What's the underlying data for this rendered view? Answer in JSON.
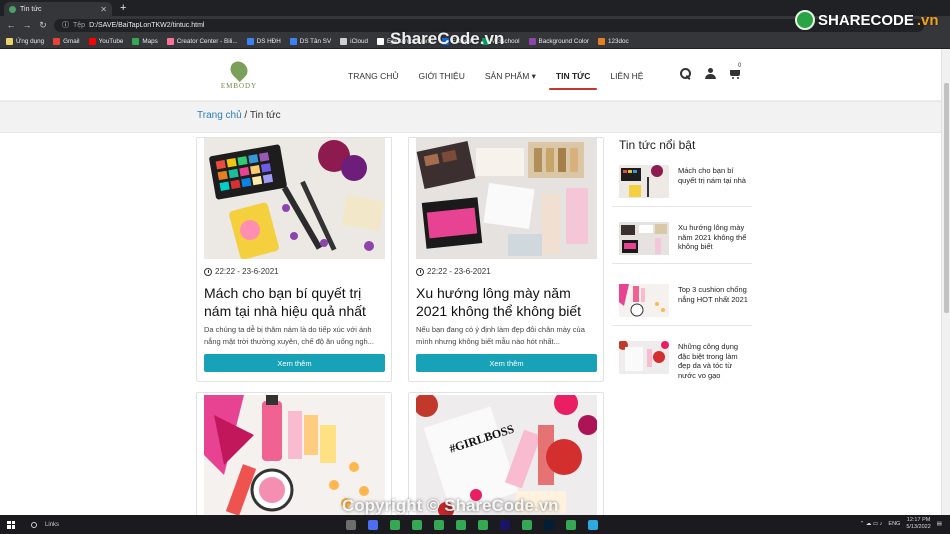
{
  "browser": {
    "tab_title": "Tin tức",
    "address_prefix": "Tệp",
    "address": "D:/SAVE/BaiTapLonTKW2/tintuc.html",
    "bookmarks": [
      {
        "label": "Ứng dụng",
        "color": "#e8d36a"
      },
      {
        "label": "Gmail",
        "color": "#ea4335"
      },
      {
        "label": "YouTube",
        "color": "#ff0000"
      },
      {
        "label": "Maps",
        "color": "#34a853"
      },
      {
        "label": "Creator Center - Bili...",
        "color": "#fb7299"
      },
      {
        "label": "DS HĐH",
        "color": "#3b82f6"
      },
      {
        "label": "DS Tân SV",
        "color": "#3b82f6"
      },
      {
        "label": "iCloud",
        "color": "#cfcfcf"
      },
      {
        "label": "Epidemic Sound",
        "color": "#ffffff"
      },
      {
        "label": "Freepik",
        "color": "#1273eb"
      },
      {
        "label": "W3school",
        "color": "#04aa6d"
      },
      {
        "label": "Background Color",
        "color": "#8e44ad"
      },
      {
        "label": "123doc",
        "color": "#e67e22"
      }
    ]
  },
  "site": {
    "logo_text": "EMBODY",
    "menu": [
      {
        "label": "TRANG CHỦ"
      },
      {
        "label": "GIỚI THIỆU"
      },
      {
        "label": "SẢN PHẨM ▾"
      },
      {
        "label": "TIN TỨC",
        "active": true
      },
      {
        "label": "LIÊN HỆ"
      }
    ],
    "cart_count": "0",
    "breadcrumb": {
      "home": "Trang chủ",
      "sep": " / ",
      "current": "Tin tức"
    }
  },
  "articles": [
    {
      "date": "22:22 - 23-6-2021",
      "title": "Mách cho bạn bí quyết trị nám tại nhà hiệu quả nhất",
      "excerpt": "Da chúng ta dễ bị thâm nám là do tiếp xúc với ánh nắng mặt trời thường xuyên, chế độ ăn uống ngh...",
      "button": "Xem thêm"
    },
    {
      "date": "22:22 - 23-6-2021",
      "title": "Xu hướng lông mày năm 2021 không thể không biết",
      "excerpt": "Nếu bạn đang có ý định làm đẹp đôi chân mày của mình nhưng không biết mẫu nào hót nhất...",
      "button": "Xem thêm"
    }
  ],
  "sidebar": {
    "title": "Tin tức nổi bật",
    "items": [
      {
        "text": "Mách cho bạn bí quyết trị nám tại nhà"
      },
      {
        "text": "Xu hướng lông mày năm 2021 không thể không biết"
      },
      {
        "text": "Top 3 cushion chống nắng HOT nhất 2021"
      },
      {
        "text": "Những công dụng đặc biệt trong làm đẹp da và tóc từ nước vo gạo"
      }
    ]
  },
  "watermark": {
    "logo_a": "SHARECODE",
    "logo_b": ".vn",
    "top": "ShareCode.vn",
    "bottom": "Copyright © ShareCode.vn"
  },
  "taskbar": {
    "search": "Links",
    "lang": "ENG",
    "time": "12:17 PM",
    "date": "5/13/2022"
  }
}
